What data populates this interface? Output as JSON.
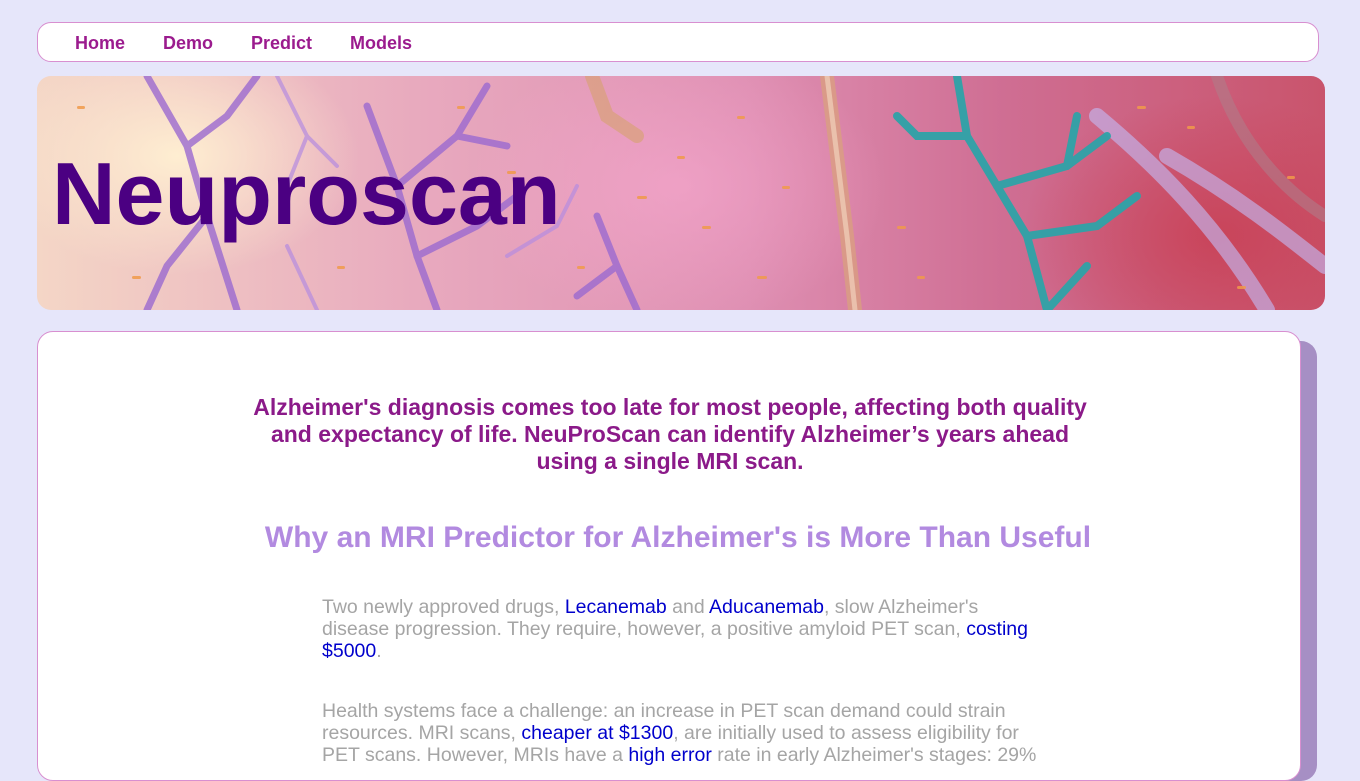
{
  "nav": {
    "items": [
      {
        "label": "Home"
      },
      {
        "label": "Demo"
      },
      {
        "label": "Predict"
      },
      {
        "label": "Models"
      }
    ]
  },
  "banner": {
    "title": "Neuproscan"
  },
  "main": {
    "intro": "Alzheimer's diagnosis comes too late for most people, affecting both quality and expectancy of life. NeuProScan can identify Alzheimer’s years ahead using a single MRI scan.",
    "section_heading": "Why an MRI Predictor for Alzheimer's is More Than Useful",
    "para1": {
      "t1": "Two newly approved drugs, ",
      "link1": "Lecanemab",
      "t2": " and ",
      "link2": "Aducanemab",
      "t3": ", slow Alzheimer's disease progression. They require, however, a positive amyloid PET scan, ",
      "link3": "costing $5000",
      "t4": "."
    },
    "para2": {
      "t1": "Health systems face a challenge: an increase in PET scan demand could strain resources. MRI scans, ",
      "link1": "cheaper at $1300",
      "t2": ", are initially used to assess eligibility for PET scans. However, MRIs have a ",
      "link2": "high error",
      "t3": " rate in early Alzheimer's stages: 29%"
    }
  },
  "colors": {
    "page_background": "#e6e6fa",
    "nav_link": "#9b1b8e",
    "title": "#4b0082",
    "intro_text": "#8b1a89",
    "section_heading": "#b28ae0",
    "body_text": "#a5a5a5",
    "link": "#0000cc",
    "card_shadow": "#a68fc4"
  }
}
